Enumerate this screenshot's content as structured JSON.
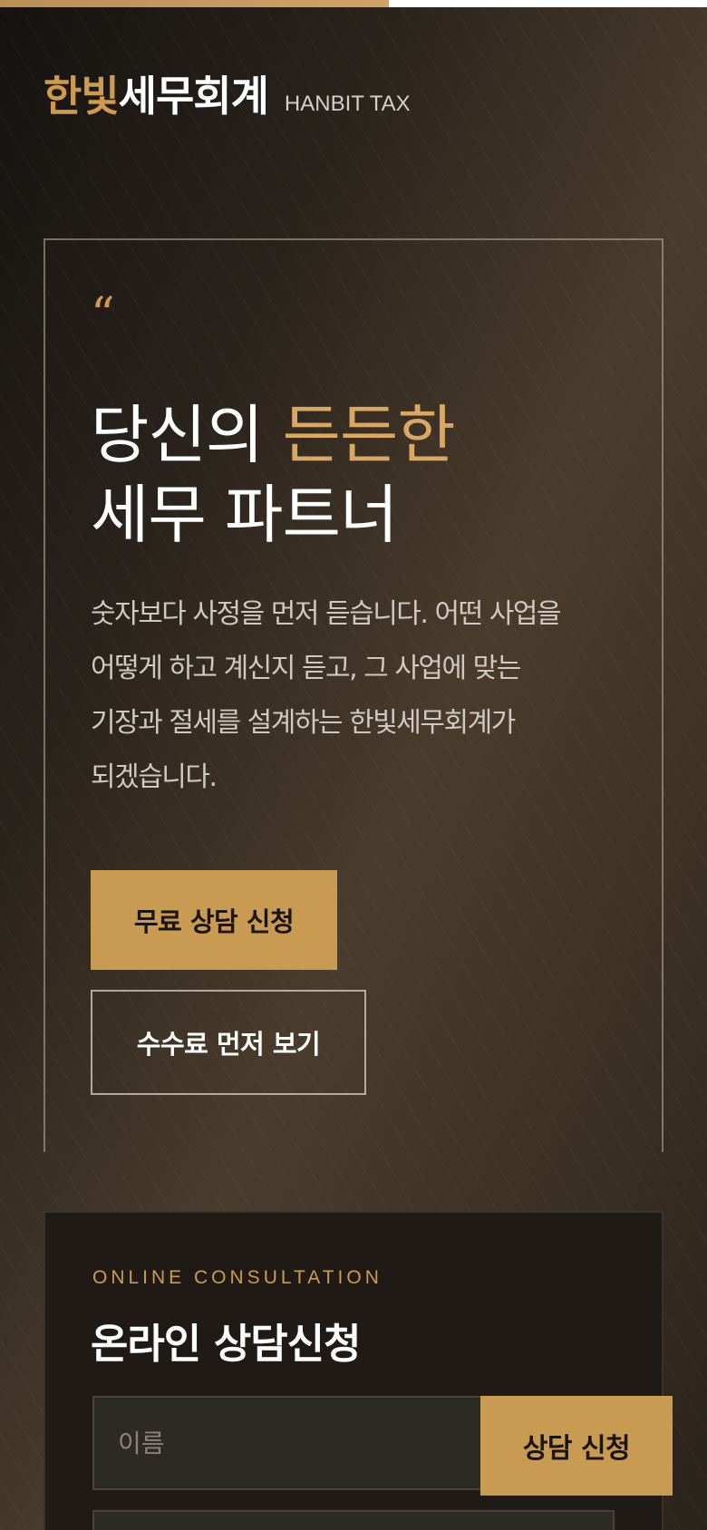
{
  "progress": {
    "fraction": 0.55
  },
  "brand": {
    "accent": "한빛",
    "main": "세무회계",
    "english": "HANBIT TAX"
  },
  "hero": {
    "quote_glyph": "“",
    "headline_line1_plain": "당신의 ",
    "headline_line1_accent": "든든한",
    "headline_line2": "세무 파트너",
    "lead_lines": [
      "숫자보다 사정을 먼저 듣습니다. 어떤 사업을",
      "어떻게 하고 계신지 듣고, 그 사업에 맞는",
      "기장과 절세를 설계하는 한빛세무회계가",
      "되겠습니다."
    ],
    "primary_cta": "무료 상담 신청",
    "secondary_cta": "수수료 먼저 보기"
  },
  "consult": {
    "eyebrow": "ONLINE CONSULTATION",
    "title": "온라인 상담신청",
    "name_placeholder": "이름",
    "name_value": "",
    "submit_label": "상담 신청"
  },
  "colors": {
    "accent": "#c99a52",
    "dark": "#1a1714",
    "text": "#ffffff"
  }
}
